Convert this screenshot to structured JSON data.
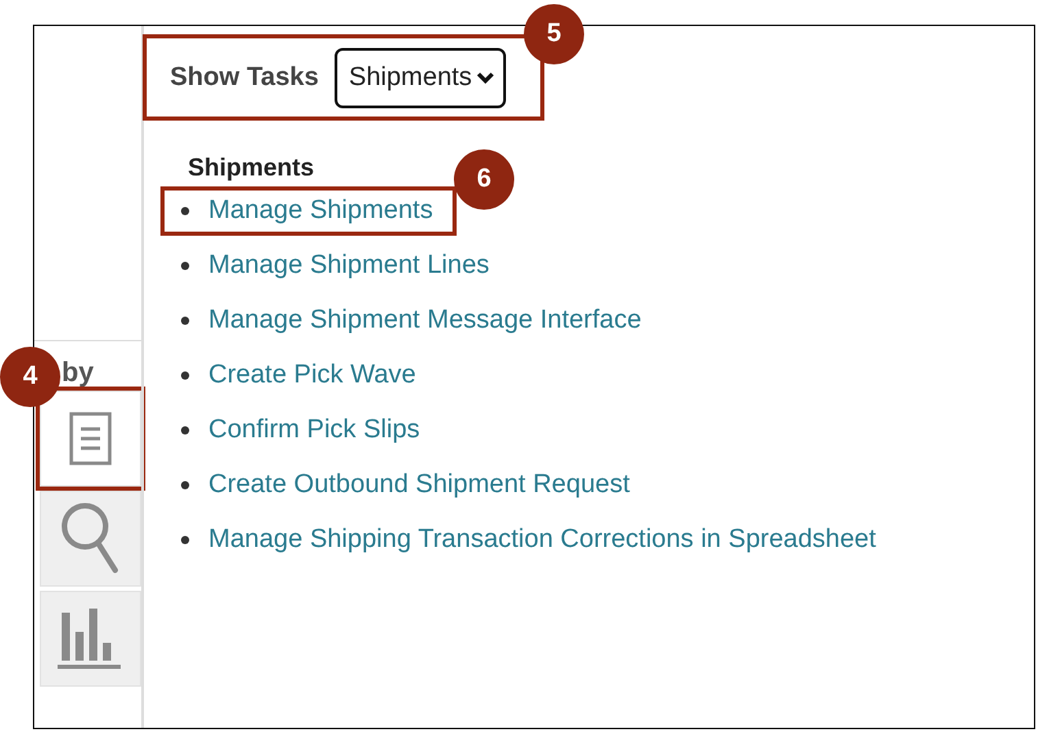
{
  "rail": {
    "partial_text": "by"
  },
  "side_tabs": [
    {
      "kind": "document",
      "selected": true,
      "highlighted": true,
      "callout": "4"
    },
    {
      "kind": "search",
      "selected": false,
      "highlighted": false
    },
    {
      "kind": "chart",
      "selected": false,
      "highlighted": false
    }
  ],
  "show_tasks": {
    "label": "Show Tasks",
    "value": "Shipments",
    "highlighted": true,
    "callout": "5"
  },
  "section": {
    "heading": "Shipments",
    "tasks": [
      {
        "label": "Manage Shipments",
        "highlighted": true,
        "callout": "6"
      },
      {
        "label": "Manage Shipment Lines",
        "highlighted": false
      },
      {
        "label": "Manage Shipment Message Interface",
        "highlighted": false
      },
      {
        "label": "Create Pick Wave",
        "highlighted": false
      },
      {
        "label": "Confirm Pick Slips",
        "highlighted": false
      },
      {
        "label": "Create Outbound Shipment Request",
        "highlighted": false
      },
      {
        "label": "Manage Shipping Transaction Corrections in Spreadsheet",
        "highlighted": false
      }
    ]
  }
}
